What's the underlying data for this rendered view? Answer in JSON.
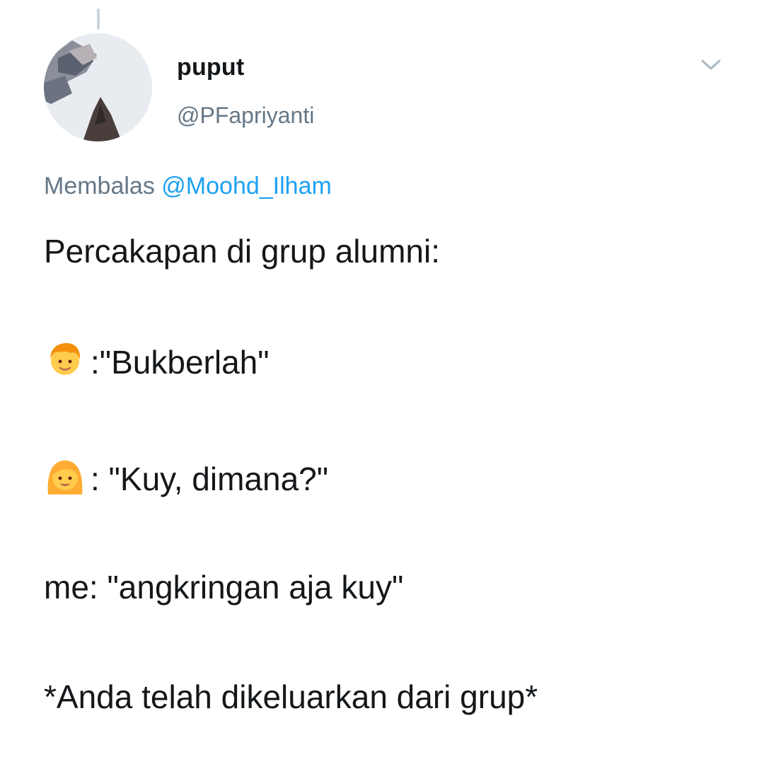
{
  "tweet": {
    "display_name": "puput",
    "handle": "@PFapriyanti",
    "reply_prefix": "Membalas",
    "reply_mention": "@Moohd_Ilham",
    "lines": [
      "Percakapan di grup alumni:",
      ":\"Bukberlah\"",
      ": \"Kuy, dimana?\"",
      "me: \"angkringan aja kuy\"",
      "*Anda telah dikeluarkan dari grup*"
    ]
  },
  "icons": {
    "line_2_emoji": "boy-emoji",
    "line_3_emoji": "woman-emoji",
    "caret": "chevron-down-icon"
  },
  "colors": {
    "text": "#14171a",
    "secondary": "#657786",
    "link": "#1da1f2",
    "caret": "#aab8c2"
  }
}
